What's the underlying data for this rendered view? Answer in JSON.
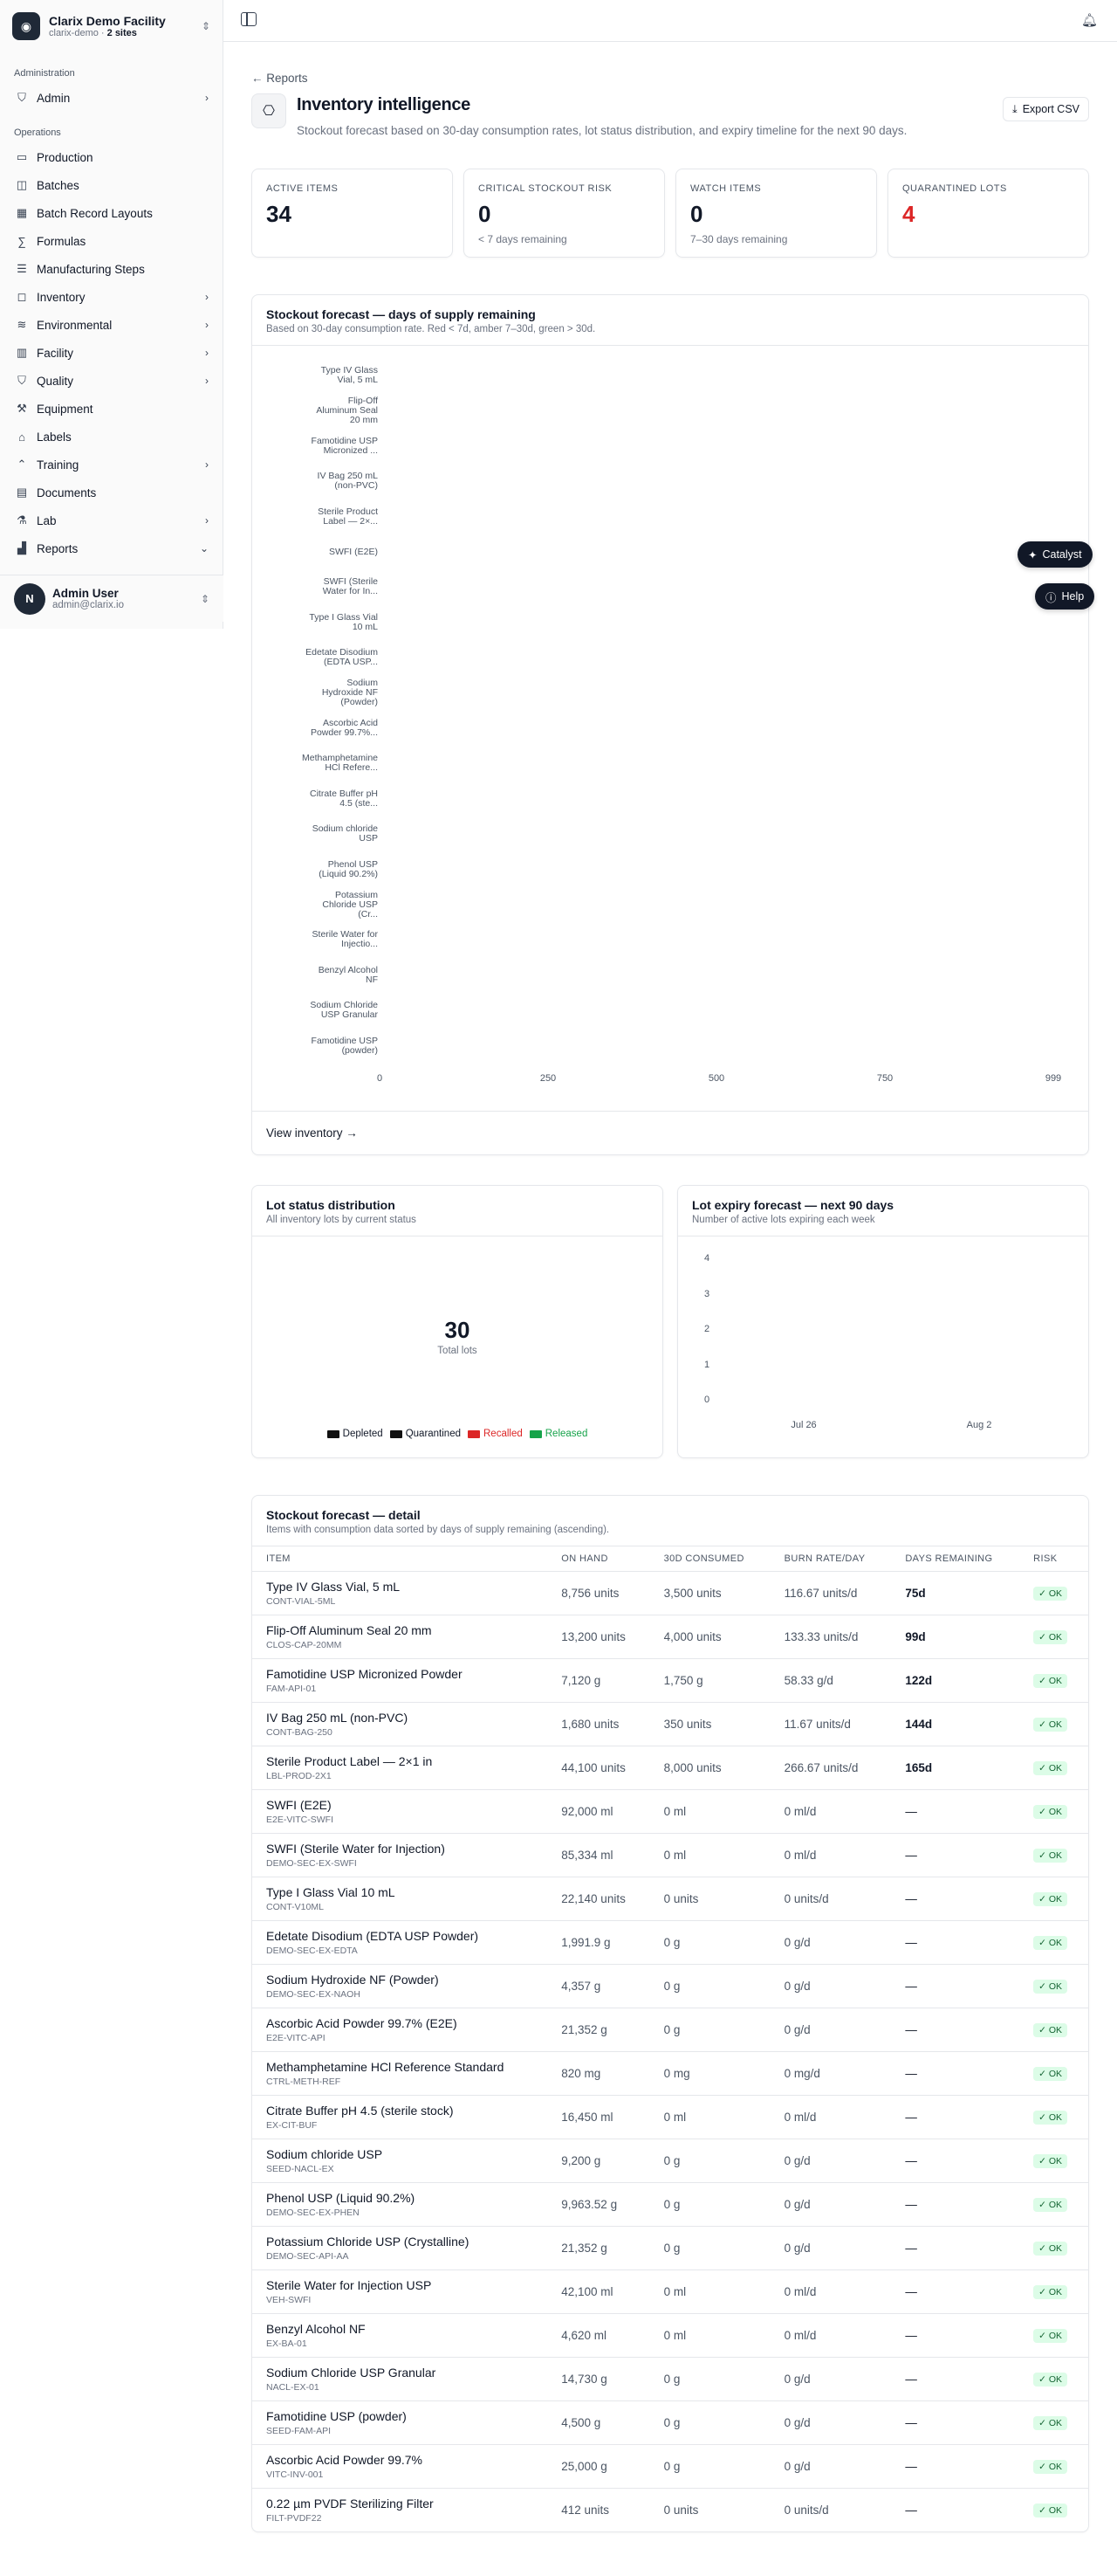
{
  "org": {
    "name": "Clarix Demo Facility",
    "slug": "clarix-demo",
    "sep": " · ",
    "sites": "2 sites"
  },
  "sidebar": {
    "sections": [
      {
        "label": "Administration",
        "items": [
          {
            "label": "Admin",
            "icon": "shield-icon",
            "chevron": true
          }
        ]
      },
      {
        "label": "Operations",
        "items": [
          {
            "label": "Production",
            "icon": "folder-icon",
            "chevron": false
          },
          {
            "label": "Batches",
            "icon": "layers-icon",
            "chevron": false
          },
          {
            "label": "Batch Record Layouts",
            "icon": "layout-icon",
            "chevron": false
          },
          {
            "label": "Formulas",
            "icon": "formula-icon",
            "chevron": false
          },
          {
            "label": "Manufacturing Steps",
            "icon": "steps-icon",
            "chevron": false
          },
          {
            "label": "Inventory",
            "icon": "box-icon",
            "chevron": true
          },
          {
            "label": "Environmental",
            "icon": "wind-icon",
            "chevron": true
          },
          {
            "label": "Facility",
            "icon": "building-icon",
            "chevron": true
          },
          {
            "label": "Quality",
            "icon": "shield-check-icon",
            "chevron": true
          },
          {
            "label": "Equipment",
            "icon": "wrench-icon",
            "chevron": false
          },
          {
            "label": "Labels",
            "icon": "tag-icon",
            "chevron": false
          },
          {
            "label": "Training",
            "icon": "graduation-icon",
            "chevron": true
          },
          {
            "label": "Documents",
            "icon": "document-icon",
            "chevron": false
          },
          {
            "label": "Lab",
            "icon": "flask-icon",
            "chevron": true
          },
          {
            "label": "Reports",
            "icon": "chart-icon",
            "chevron": true,
            "expanded": true
          }
        ]
      }
    ]
  },
  "user": {
    "initial": "N",
    "name": "Admin User",
    "email": "admin@clarix.io"
  },
  "page": {
    "back": "← Reports",
    "title": "Inventory intelligence",
    "description": "Stockout forecast based on 30-day consumption rates, lot status distribution, and expiry timeline for the next 90 days.",
    "export_label": "Export CSV"
  },
  "stats": [
    {
      "label": "ACTIVE ITEMS",
      "value": "34",
      "sub": "",
      "red": false
    },
    {
      "label": "CRITICAL STOCKOUT RISK",
      "value": "0",
      "sub": "< 7 days remaining",
      "red": false
    },
    {
      "label": "WATCH ITEMS",
      "value": "0",
      "sub": "7–30 days remaining",
      "red": false
    },
    {
      "label": "QUARANTINED LOTS",
      "value": "4",
      "sub": "",
      "red": true
    }
  ],
  "stockout_chart": {
    "title": "Stockout forecast — days of supply remaining",
    "subtitle": "Based on 30-day consumption rate. Red < 7d, amber 7–30d, green > 30d.",
    "footer": "View inventory →",
    "chart_data": {
      "type": "bar",
      "orientation": "horizontal",
      "categories": [
        [
          "Type IV Glass",
          "Vial, 5 mL"
        ],
        [
          "Flip-Off",
          "Aluminum Seal",
          "20 mm"
        ],
        [
          "Famotidine USP",
          "Micronized ..."
        ],
        [
          "IV Bag 250 mL",
          "(non-PVC)"
        ],
        [
          "Sterile Product",
          "Label — 2×..."
        ],
        [
          "SWFI (E2E)"
        ],
        [
          "SWFI (Sterile",
          "Water for In..."
        ],
        [
          "Type I Glass Vial",
          "10 mL"
        ],
        [
          "Edetate Disodium",
          "(EDTA USP..."
        ],
        [
          "Sodium",
          "Hydroxide NF",
          "(Powder)"
        ],
        [
          "Ascorbic Acid",
          "Powder 99.7%..."
        ],
        [
          "Methamphetamine",
          "HCl Refere..."
        ],
        [
          "Citrate Buffer pH",
          "4.5 (ste..."
        ],
        [
          "Sodium chloride",
          "USP"
        ],
        [
          "Phenol USP",
          "(Liquid 90.2%)"
        ],
        [
          "Potassium",
          "Chloride USP",
          "(Cr..."
        ],
        [
          "Sterile Water for",
          "Injectio..."
        ],
        [
          "Benzyl Alcohol",
          "NF"
        ],
        [
          "Sodium Chloride",
          "USP Granular"
        ],
        [
          "Famotidine USP",
          "(powder)"
        ]
      ],
      "values": [
        0,
        0,
        0,
        0,
        0,
        0,
        0,
        0,
        0,
        0,
        0,
        0,
        0,
        0,
        0,
        0,
        0,
        0,
        0,
        0
      ],
      "xticks": [
        "0",
        "250",
        "500",
        "750",
        "999"
      ],
      "xlim": [
        0,
        999
      ]
    }
  },
  "lot_status": {
    "title": "Lot status distribution",
    "subtitle": "All inventory lots by current status",
    "total": "30",
    "total_label": "Total lots",
    "chart_data": {
      "type": "pie",
      "legend": [
        {
          "name": "Depleted",
          "color": "#111111"
        },
        {
          "name": "Quarantined",
          "color": "#111111"
        },
        {
          "name": "Recalled",
          "color": "#dc2626"
        },
        {
          "name": "Released",
          "color": "#16a34a"
        }
      ]
    }
  },
  "lot_expiry": {
    "title": "Lot expiry forecast — next 90 days",
    "subtitle": "Number of active lots expiring each week",
    "chart_data": {
      "type": "bar",
      "categories": [
        "Jul 26",
        "Aug 2"
      ],
      "values": [
        0,
        0
      ],
      "yticks": [
        "0",
        "1",
        "2",
        "3",
        "4"
      ],
      "ylim": [
        0,
        4
      ]
    }
  },
  "detail": {
    "title": "Stockout forecast — detail",
    "subtitle": "Items with consumption data sorted by days of supply remaining (ascending).",
    "columns": [
      "ITEM",
      "ON HAND",
      "30D CONSUMED",
      "BURN RATE/DAY",
      "DAYS REMAINING",
      "RISK"
    ],
    "rows": [
      {
        "name": "Type IV Glass Vial, 5 mL",
        "code": "CONT-VIAL-5ML",
        "on_hand": "8,756 units",
        "consumed": "3,500 units",
        "burn": "116.67 units/d",
        "days": "75d",
        "risk": "✓ OK"
      },
      {
        "name": "Flip-Off Aluminum Seal 20 mm",
        "code": "CLOS-CAP-20MM",
        "on_hand": "13,200 units",
        "consumed": "4,000 units",
        "burn": "133.33 units/d",
        "days": "99d",
        "risk": "✓ OK"
      },
      {
        "name": "Famotidine USP Micronized Powder",
        "code": "FAM-API-01",
        "on_hand": "7,120 g",
        "consumed": "1,750 g",
        "burn": "58.33 g/d",
        "days": "122d",
        "risk": "✓ OK"
      },
      {
        "name": "IV Bag 250 mL (non-PVC)",
        "code": "CONT-BAG-250",
        "on_hand": "1,680 units",
        "consumed": "350 units",
        "burn": "11.67 units/d",
        "days": "144d",
        "risk": "✓ OK"
      },
      {
        "name": "Sterile Product Label — 2×1 in",
        "code": "LBL-PROD-2X1",
        "on_hand": "44,100 units",
        "consumed": "8,000 units",
        "burn": "266.67 units/d",
        "days": "165d",
        "risk": "✓ OK"
      },
      {
        "name": "SWFI (E2E)",
        "code": "E2E-VITC-SWFI",
        "on_hand": "92,000 ml",
        "consumed": "0 ml",
        "burn": "0 ml/d",
        "days": "—",
        "risk": "✓ OK"
      },
      {
        "name": "SWFI (Sterile Water for Injection)",
        "code": "DEMO-SEC-EX-SWFI",
        "on_hand": "85,334 ml",
        "consumed": "0 ml",
        "burn": "0 ml/d",
        "days": "—",
        "risk": "✓ OK"
      },
      {
        "name": "Type I Glass Vial 10 mL",
        "code": "CONT-V10ML",
        "on_hand": "22,140 units",
        "consumed": "0 units",
        "burn": "0 units/d",
        "days": "—",
        "risk": "✓ OK"
      },
      {
        "name": "Edetate Disodium (EDTA USP Powder)",
        "code": "DEMO-SEC-EX-EDTA",
        "on_hand": "1,991.9 g",
        "consumed": "0 g",
        "burn": "0 g/d",
        "days": "—",
        "risk": "✓ OK"
      },
      {
        "name": "Sodium Hydroxide NF (Powder)",
        "code": "DEMO-SEC-EX-NAOH",
        "on_hand": "4,357 g",
        "consumed": "0 g",
        "burn": "0 g/d",
        "days": "—",
        "risk": "✓ OK"
      },
      {
        "name": "Ascorbic Acid Powder 99.7% (E2E)",
        "code": "E2E-VITC-API",
        "on_hand": "21,352 g",
        "consumed": "0 g",
        "burn": "0 g/d",
        "days": "—",
        "risk": "✓ OK"
      },
      {
        "name": "Methamphetamine HCl Reference Standard",
        "code": "CTRL-METH-REF",
        "on_hand": "820 mg",
        "consumed": "0 mg",
        "burn": "0 mg/d",
        "days": "—",
        "risk": "✓ OK"
      },
      {
        "name": "Citrate Buffer pH 4.5 (sterile stock)",
        "code": "EX-CIT-BUF",
        "on_hand": "16,450 ml",
        "consumed": "0 ml",
        "burn": "0 ml/d",
        "days": "—",
        "risk": "✓ OK"
      },
      {
        "name": "Sodium chloride USP",
        "code": "SEED-NACL-EX",
        "on_hand": "9,200 g",
        "consumed": "0 g",
        "burn": "0 g/d",
        "days": "—",
        "risk": "✓ OK"
      },
      {
        "name": "Phenol USP (Liquid 90.2%)",
        "code": "DEMO-SEC-EX-PHEN",
        "on_hand": "9,963.52 g",
        "consumed": "0 g",
        "burn": "0 g/d",
        "days": "—",
        "risk": "✓ OK"
      },
      {
        "name": "Potassium Chloride USP (Crystalline)",
        "code": "DEMO-SEC-API-AA",
        "on_hand": "21,352 g",
        "consumed": "0 g",
        "burn": "0 g/d",
        "days": "—",
        "risk": "✓ OK"
      },
      {
        "name": "Sterile Water for Injection USP",
        "code": "VEH-SWFI",
        "on_hand": "42,100 ml",
        "consumed": "0 ml",
        "burn": "0 ml/d",
        "days": "—",
        "risk": "✓ OK"
      },
      {
        "name": "Benzyl Alcohol NF",
        "code": "EX-BA-01",
        "on_hand": "4,620 ml",
        "consumed": "0 ml",
        "burn": "0 ml/d",
        "days": "—",
        "risk": "✓ OK"
      },
      {
        "name": "Sodium Chloride USP Granular",
        "code": "NACL-EX-01",
        "on_hand": "14,730 g",
        "consumed": "0 g",
        "burn": "0 g/d",
        "days": "—",
        "risk": "✓ OK"
      },
      {
        "name": "Famotidine USP (powder)",
        "code": "SEED-FAM-API",
        "on_hand": "4,500 g",
        "consumed": "0 g",
        "burn": "0 g/d",
        "days": "—",
        "risk": "✓ OK"
      },
      {
        "name": "Ascorbic Acid Powder 99.7%",
        "code": "VITC-INV-001",
        "on_hand": "25,000 g",
        "consumed": "0 g",
        "burn": "0 g/d",
        "days": "—",
        "risk": "✓ OK"
      },
      {
        "name": "0.22 µm PVDF Sterilizing Filter",
        "code": "FILT-PVDF22",
        "on_hand": "412 units",
        "consumed": "0 units",
        "burn": "0 units/d",
        "days": "—",
        "risk": "✓ OK"
      }
    ]
  },
  "floating": {
    "catalyst": "Catalyst",
    "help": "Help"
  }
}
